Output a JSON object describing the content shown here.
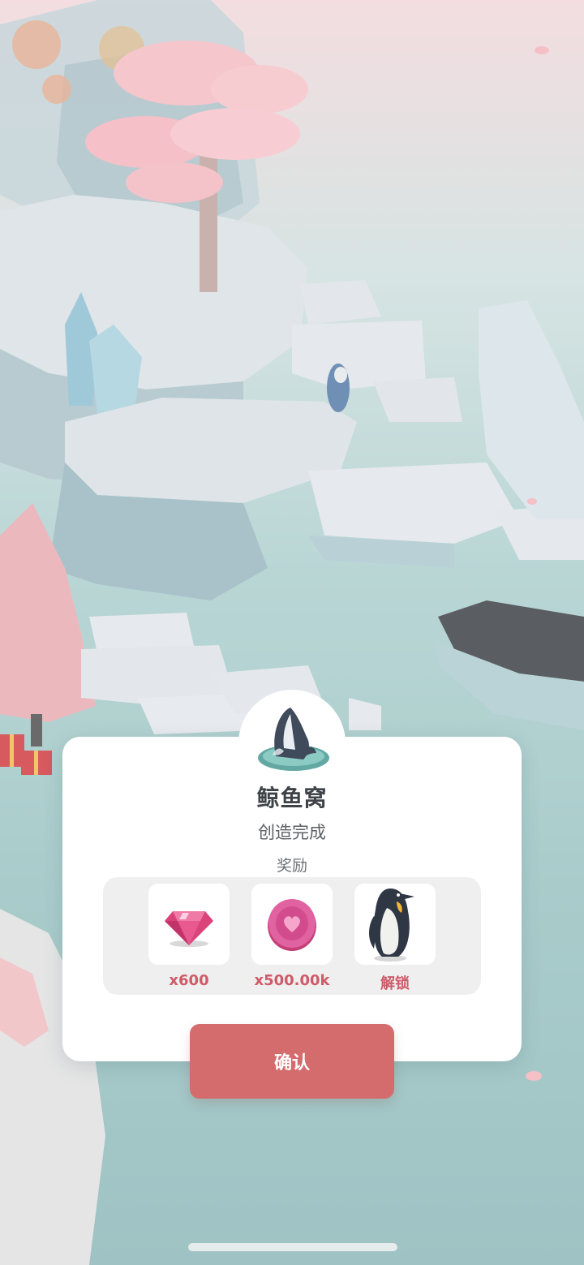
{
  "dialog": {
    "title": "鲸鱼窝",
    "subtitle": "创造完成",
    "reward_label": "奖励",
    "rewards": [
      {
        "icon": "gem-icon",
        "amount": "x600"
      },
      {
        "icon": "heart-coin-icon",
        "amount": "x500.00k"
      },
      {
        "icon": "penguin-icon",
        "amount": "解锁"
      }
    ],
    "confirm_label": "确认",
    "badge_icon": "whale-icon"
  },
  "colors": {
    "accent": "#d46c6e",
    "reward_text": "#cf5a68",
    "title_text": "#3e4348",
    "panel_bg": "#efefef"
  }
}
